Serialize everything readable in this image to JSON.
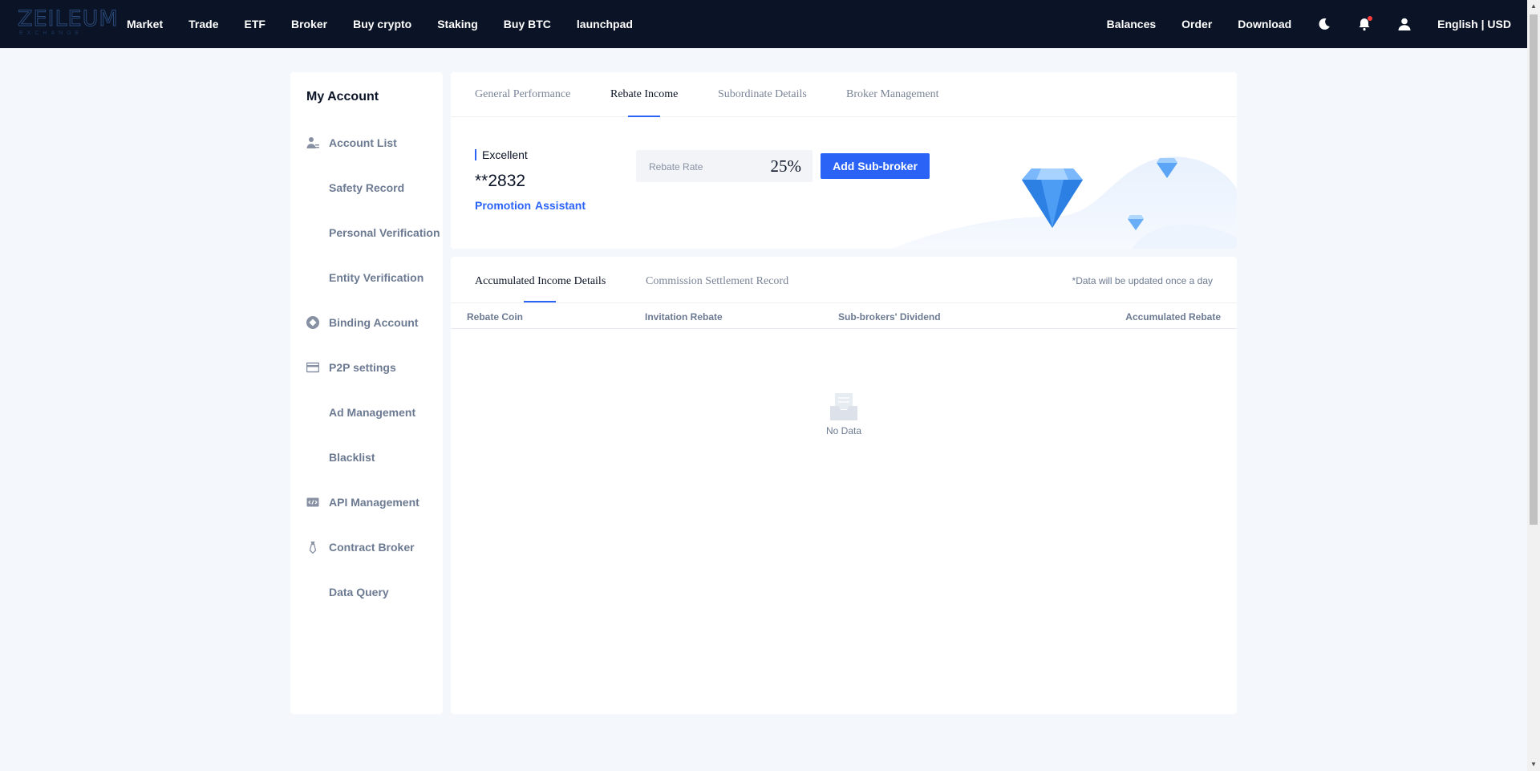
{
  "brand": {
    "logo_main": "ZEILEUM",
    "logo_sub": "EXCHANGE"
  },
  "nav": {
    "left": [
      "Market",
      "Trade",
      "ETF",
      "Broker",
      "Buy crypto",
      "Staking",
      "Buy BTC",
      "launchpad"
    ],
    "right": {
      "balances": "Balances",
      "order": "Order",
      "download": "Download",
      "language": "English | USD"
    },
    "icons": [
      "moon-icon",
      "bell-icon",
      "user-icon"
    ]
  },
  "sidebar": {
    "title": "My Account",
    "items": [
      {
        "label": "Account List",
        "icon": "account-icon",
        "sub": false
      },
      {
        "label": "Safety Record",
        "sub": true
      },
      {
        "label": "Personal Verification",
        "sub": true
      },
      {
        "label": "Entity Verification",
        "sub": true
      },
      {
        "label": "Binding Account",
        "icon": "binding-icon",
        "sub": false
      },
      {
        "label": "P2P settings",
        "icon": "card-icon",
        "sub": false
      },
      {
        "label": "Ad Management",
        "sub": true
      },
      {
        "label": "Blacklist",
        "sub": true
      },
      {
        "label": "API Management",
        "icon": "api-icon",
        "sub": false
      },
      {
        "label": "Contract Broker",
        "icon": "tie-icon",
        "sub": false
      },
      {
        "label": "Data Query",
        "sub": true
      }
    ]
  },
  "tabs": [
    "General Performance",
    "Rebate Income",
    "Subordinate Details",
    "Broker Management"
  ],
  "active_tab": "Rebate Income",
  "broker": {
    "level": "Excellent",
    "uid": "**2832",
    "links": [
      "Promotion",
      "Assistant"
    ],
    "rate_label": "Rebate Rate",
    "rate_value": "25%",
    "add_button": "Add Sub-broker"
  },
  "income": {
    "tabs": [
      "Accumulated Income Details",
      "Commission Settlement Record"
    ],
    "note": "*Data will be updated once a day",
    "columns": [
      "Rebate Coin",
      "Invitation Rebate",
      "Sub-brokers' Dividend",
      "Accumulated Rebate"
    ],
    "empty_text": "No Data"
  },
  "colors": {
    "accent": "#2a63f6",
    "nav_bg": "#0b1426",
    "page_bg": "#f4f7fc"
  }
}
